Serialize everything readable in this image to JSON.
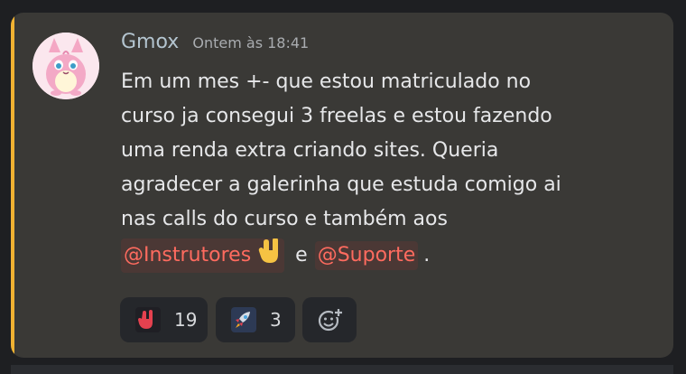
{
  "message": {
    "username": "Gmox",
    "timestamp": "Ontem às 18:41",
    "lines": [
      "Em um mes +- que estou matriculado no",
      "curso ja consegui 3 freelas e estou fazendo",
      "uma renda extra criando sites. Queria",
      "agradecer a galerinha que estuda comigo ai",
      "nas calls do curso e também aos"
    ],
    "mention_1": "@Instrutores",
    "conjunction": "e",
    "mention_2": "@Suporte",
    "end_punct": ".",
    "accent_color": "#f0b232",
    "mention_color": "#ff6b5f"
  },
  "reactions": [
    {
      "icon": "rock-hand-icon",
      "count": "19"
    },
    {
      "icon": "rocket-icon",
      "count": "3"
    },
    {
      "icon": "add-reaction-icon"
    }
  ]
}
